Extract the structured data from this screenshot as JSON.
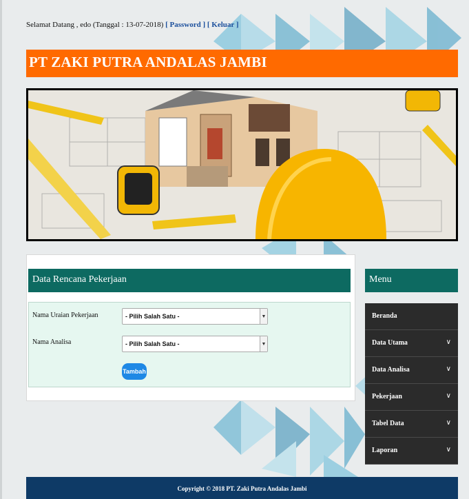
{
  "topbar": {
    "welcome": "Selamat Datang , edo (Tanggal : 13-07-2018)",
    "password_link": "[ Password ]",
    "logout_link": "[ Keluar ]"
  },
  "header": {
    "title": "PT ZAKI PUTRA ANDALAS JAMBI"
  },
  "panel": {
    "title": "Data Rencana Pekerjaan",
    "fields": [
      {
        "label": "Nama Uraian Pekerjaan",
        "value": "- Pilih Salah Satu -"
      },
      {
        "label": "Nama Analisa",
        "value": "- Pilih Salah Satu -"
      }
    ],
    "submit_label": "Tambah"
  },
  "menu": {
    "title": "Menu",
    "items": [
      {
        "label": "Beranda",
        "chevron": ""
      },
      {
        "label": "Data Utama",
        "chevron": "∨"
      },
      {
        "label": "Data Analisa",
        "chevron": "∨"
      },
      {
        "label": "Pekerjaan",
        "chevron": "∨"
      },
      {
        "label": "Tabel Data",
        "chevron": "∨"
      },
      {
        "label": "Laporan",
        "chevron": "∨"
      }
    ]
  },
  "footer": {
    "copyright": "Copyright © 2018 PT. Zaki Putra Andalas Jambi"
  },
  "colors": {
    "header": "#ff6a00",
    "panel_head": "#0d6a61",
    "menu_item": "#2b2b2b",
    "footer": "#0e3a66",
    "button": "#1e88e5"
  }
}
